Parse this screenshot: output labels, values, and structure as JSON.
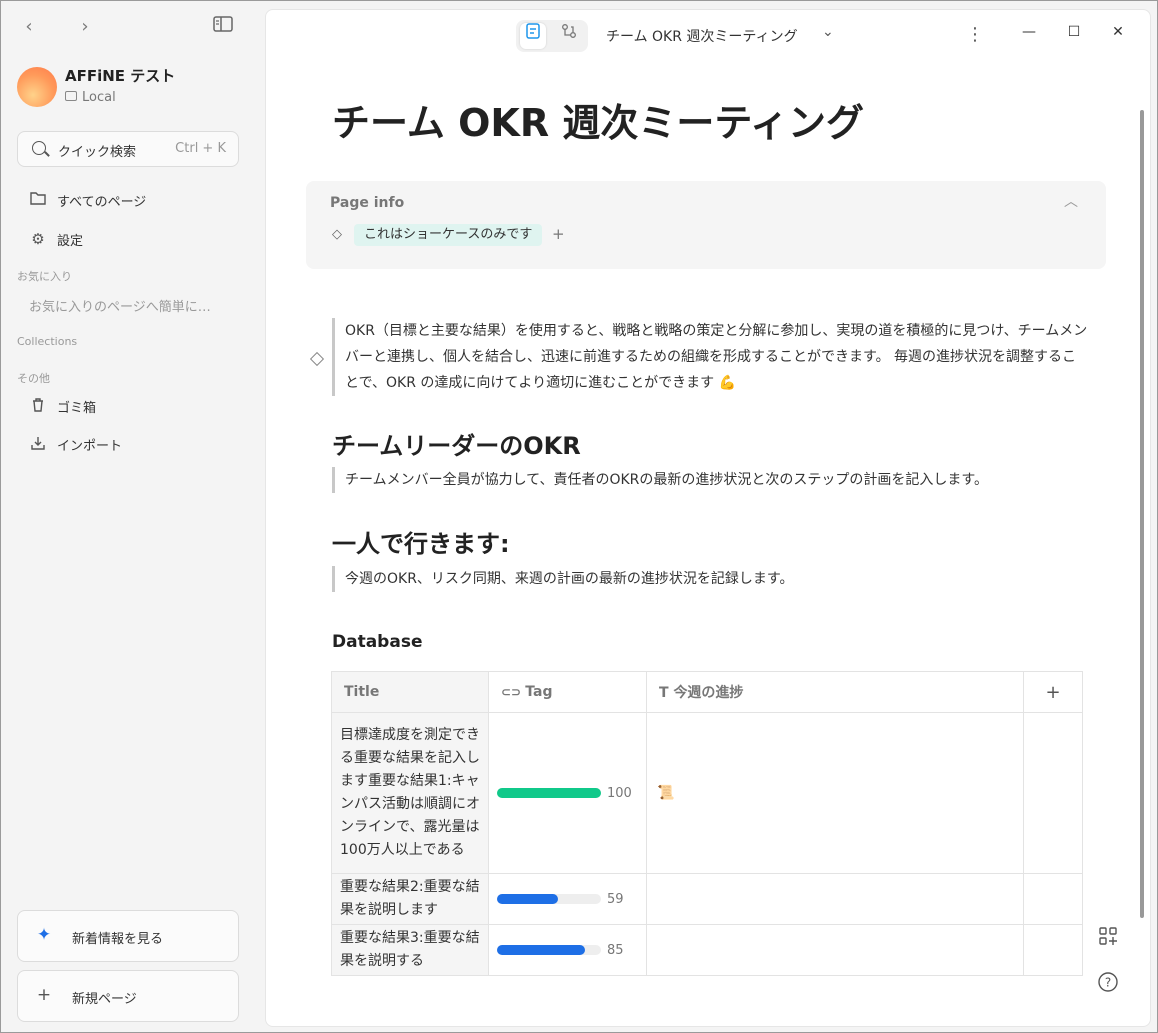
{
  "sidebar": {
    "back_icon": "‹",
    "forward_icon": "›",
    "workspace_name": "AFFiNE テスト",
    "workspace_type": "Local",
    "search_label": "クイック検索",
    "search_shortcut": "Ctrl + K",
    "all_pages": "すべてのページ",
    "settings": "設定",
    "favorites_header": "お気に入り",
    "favorites_empty": "お気に入りのページへ簡単に…",
    "collections_header": "Collections",
    "others_header": "その他",
    "trash": "ゴミ箱",
    "import": "インポート",
    "whats_new": "新着情報を見る",
    "new_page": "新規ページ"
  },
  "topbar": {
    "doc_title": "チーム OKR 週次ミーティング",
    "chevron": "⌄",
    "more": "⋮",
    "minimize": "—",
    "maximize": "☐",
    "close": "✕"
  },
  "doc": {
    "title": "チーム OKR 週次ミーティング",
    "page_info_label": "Page info",
    "tag": "これはショーケースのみです",
    "intro": "OKR（目標と主要な結果）を使用すると、戦略と戦略の策定と分解に参加し、実現の道を積極的に見つけ、チームメンバーと連携し、個人を結合し、迅速に前進するための組織を形成することができます。 毎週の進捗状況を調整することで、OKR の達成に向けてより適切に進むことができます 💪",
    "h_leader": "チームリーダーのOKR",
    "leader_text": "チームメンバー全員が協力して、責任者のOKRの最新の進捗状況と次のステップの計画を記入します。",
    "h_solo": "一人で行きます:",
    "solo_text": "今週のOKR、リスク同期、来週の計画の最新の進捗状況を記録します。",
    "database_title": "Database"
  },
  "database": {
    "columns": [
      "Title",
      "Tag",
      "今週の進捗"
    ],
    "add_column": "+",
    "rows": [
      {
        "title": "目標達成度を測定できる重要な結果を記入します重要な結果1:キャンパス活動は順調にオンラインで、露光量は100万人以上である",
        "progress": 100,
        "color": "#10c98a",
        "note": "📜"
      },
      {
        "title": "重要な結果2:重要な結果を説明します",
        "progress": 59,
        "color": "#1e6fe6",
        "note": ""
      },
      {
        "title": "重要な結果3:重要な結果を説明する",
        "progress": 85,
        "color": "#1e6fe6",
        "note": ""
      }
    ]
  }
}
